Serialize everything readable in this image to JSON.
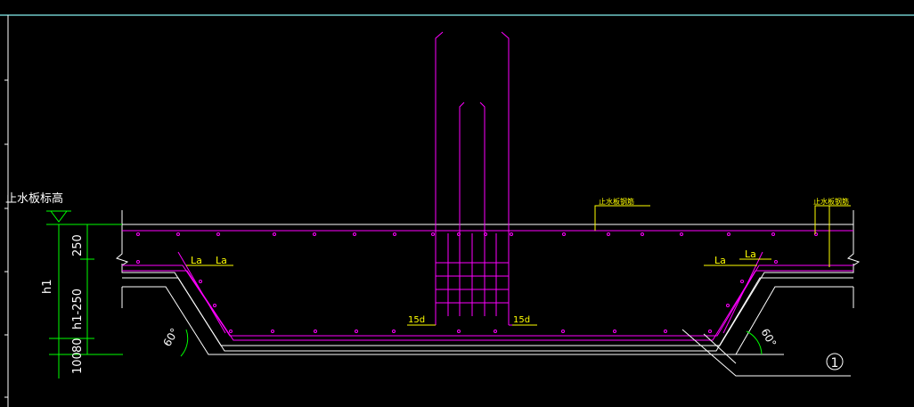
{
  "colors": {
    "background": "#000000",
    "structure": "#ffffff",
    "rebar": "#ff00ff",
    "dimension": "#00ff00",
    "label": "#ffff00",
    "frame_top": "#6fc8c8"
  },
  "labels": {
    "waterstop_elevation": "止水板标高",
    "waterstop_rebar_1": "止水板钢筋",
    "waterstop_rebar_2": "止水板钢筋",
    "anchor_left_1": "La",
    "anchor_left_2": "La",
    "anchor_right_1": "La",
    "anchor_right_2": "La",
    "hook_left": "15d",
    "hook_right": "15d",
    "angle_left": "60°",
    "angle_right": "60°",
    "callout": "1"
  },
  "dimensions": {
    "overall": "h1",
    "upper": "250",
    "middle": "h1-250",
    "cushion": "80",
    "blinding": "100"
  }
}
